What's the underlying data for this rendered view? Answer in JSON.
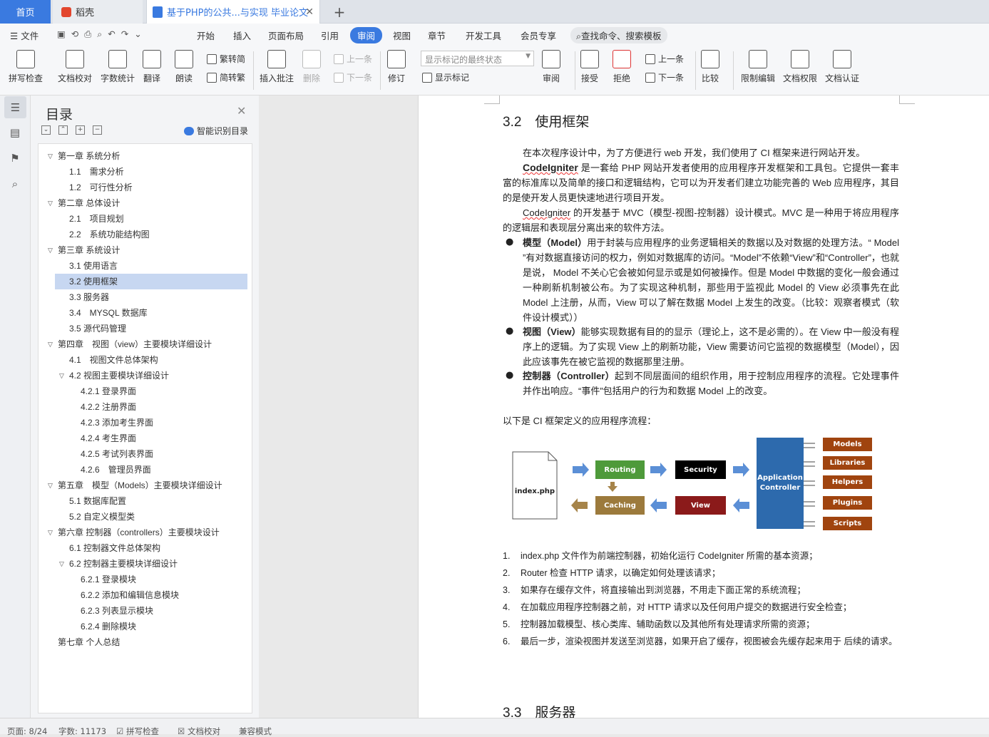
{
  "tabs": {
    "home": "首页",
    "daoke": "稻壳",
    "doc": "基于PHP的公共...与实现 毕业论文",
    "new": "+"
  },
  "menu": {
    "file": "文件",
    "items": [
      "开始",
      "插入",
      "页面布局",
      "引用",
      "审阅",
      "视图",
      "章节",
      "开发工具",
      "会员专享"
    ],
    "active": "审阅",
    "search": "查找命令、搜索模板"
  },
  "ribbon": {
    "spell": "拼写检查",
    "proof": "文档校对",
    "count": "字数统计",
    "translate": "翻译",
    "read": "朗读",
    "trad": "繁转简",
    "simp": "简转繁",
    "insert_comment": "插入批注",
    "delete": "删除",
    "prev": "上一条",
    "next": "下一条",
    "revise": "修订",
    "display_select": "显示标记的最终状态",
    "show_marks": "显示标记",
    "review": "审阅",
    "accept": "接受",
    "reject": "拒绝",
    "prev2": "上一条",
    "next2": "下一条",
    "compare": "比较",
    "restrict": "限制编辑",
    "perm": "文档权限",
    "cert": "文档认证"
  },
  "toc": {
    "title": "目录",
    "ai": "智能识别目录",
    "items": [
      {
        "text": "第一章 系统分析",
        "level": 0,
        "caret": "v"
      },
      {
        "text": "1.1　需求分析",
        "level": 1
      },
      {
        "text": "1.2　可行性分析",
        "level": 1
      },
      {
        "text": "第二章 总体设计",
        "level": 0,
        "caret": "v"
      },
      {
        "text": "2.1　项目规划",
        "level": 1
      },
      {
        "text": "2.2　系统功能结构图",
        "level": 1
      },
      {
        "text": "第三章 系统设计",
        "level": 0,
        "caret": "v"
      },
      {
        "text": "3.1 使用语言",
        "level": 1
      },
      {
        "text": "3.2 使用框架",
        "level": 1,
        "selected": true
      },
      {
        "text": "3.3 服务器",
        "level": 1
      },
      {
        "text": "3.4　MYSQL 数据库",
        "level": 1
      },
      {
        "text": "3.5 源代码管理",
        "level": 1
      },
      {
        "text": "第四章　视图（view）主要模块详细设计",
        "level": 0,
        "caret": "v"
      },
      {
        "text": "4.1　视图文件总体架构",
        "level": 1
      },
      {
        "text": "4.2 视图主要模块详细设计",
        "level": 1,
        "caret": "v"
      },
      {
        "text": "4.2.1 登录界面",
        "level": 2
      },
      {
        "text": "4.2.2 注册界面",
        "level": 2
      },
      {
        "text": "4.2.3 添加考生界面",
        "level": 2
      },
      {
        "text": "4.2.4 考生界面",
        "level": 2
      },
      {
        "text": "4.2.5 考试列表界面",
        "level": 2
      },
      {
        "text": "4.2.6　管理员界面",
        "level": 2
      },
      {
        "text": "第五章　模型（Models）主要模块详细设计",
        "level": 0,
        "caret": "v"
      },
      {
        "text": "5.1 数据库配置",
        "level": 1
      },
      {
        "text": "5.2 自定义模型类",
        "level": 1
      },
      {
        "text": "第六章 控制器（controllers）主要模块设计",
        "level": 0,
        "caret": "v"
      },
      {
        "text": "6.1 控制器文件总体架构",
        "level": 1
      },
      {
        "text": "6.2 控制器主要模块详细设计",
        "level": 1,
        "caret": "v"
      },
      {
        "text": "6.2.1 登录模块",
        "level": 2
      },
      {
        "text": "6.2.2 添加和编辑信息模块",
        "level": 2
      },
      {
        "text": "6.2.3 列表显示模块",
        "level": 2
      },
      {
        "text": "6.2.4 删除模块",
        "level": 2
      },
      {
        "text": "第七章 个人总结",
        "level": 0
      }
    ]
  },
  "doc": {
    "h_32": "3.2　使用框架",
    "p1": "在本次程序设计中，为了方便进行 web 开发，我们使用了 CI 框架来进行网站开发。",
    "p2a": "CodeIgniter",
    "p2b": " 是一套给 PHP 网站开发者使用的应用程序开发框架和工具包。它提供一套丰富的标准库以及简单的接口和逻辑结构，它可以为开发者们建立功能完善的 Web 应用程序，其目的是使开发人员更快速地进行项目开发。",
    "p3a": "CodeIgniter",
    "p3b": " 的开发基于 MVC（模型-视图-控制器）设计模式。MVC 是一种用于将应用程序的逻辑层和表现层分离出来的软件方法。",
    "b1a": "模型（Model）",
    "b1b": "用于封装与应用程序的业务逻辑相关的数据以及对数据的处理方法。“ Model ”有对数据直接访问的权力，例如对数据库的访问。“Model”不依赖“View”和“Controller”，也就是说， Model 不关心它会被如何显示或是如何被操作。但是 Model 中数据的变化一般会通过一种刷新机制被公布。为了实现这种机制，那些用于监视此 Model 的 View 必须事先在此 Model 上注册，从而，View 可以了解在数据 Model 上发生的改变。（比较：观察者模式（软件设计模式））",
    "b2a": "视图（View）",
    "b2b": "能够实现数据有目的的显示（理论上，这不是必需的）。在 View 中一般没有程序上的逻辑。为了实现 View 上的刷新功能，View 需要访问它监视的数据模型（Model），因此应该事先在被它监视的数据那里注册。",
    "b3a": "控制器（Controller）",
    "b3b": "起到不同层面间的组织作用，用于控制应用程序的流程。它处理事件并作出响应。“事件”包括用户的行为和数据 Model 上的改变。",
    "p4": "以下是 CI 框架定义的应用程序流程：",
    "flow": {
      "index": "index.php",
      "routing": "Routing",
      "security": "Security",
      "caching": "Caching",
      "view": "View",
      "app": "Application Controller",
      "models": "Models",
      "libraries": "Libraries",
      "helpers": "Helpers",
      "plugins": "Plugins",
      "scripts": "Scripts"
    },
    "list": [
      {
        "n": "1.",
        "t": "index.php 文件作为前端控制器，初始化运行 CodeIgniter 所需的基本资源；"
      },
      {
        "n": "2.",
        "t": "Router 检查 HTTP 请求，以确定如何处理该请求；"
      },
      {
        "n": "3.",
        "t": "如果存在缓存文件，将直接输出到浏览器，不用走下面正常的系统流程；"
      },
      {
        "n": "4.",
        "t": "在加载应用程序控制器之前，对 HTTP 请求以及任何用户提交的数据进行安全检查；"
      },
      {
        "n": "5.",
        "t": "控制器加载模型、核心类库、辅助函数以及其他所有处理请求所需的资源；"
      },
      {
        "n": "6.",
        "t": "最后一步，渲染视图并发送至浏览器，如果开启了缓存，视图被会先缓存起来用于 后续的请求。"
      }
    ],
    "h_33": "3.3　服务器"
  },
  "status": {
    "page": "页面: 8/24",
    "words": "字数: 11173",
    "spell": "拼写检查",
    "proof": "文档校对",
    "compat": "兼容模式"
  },
  "colors": {
    "accent": "#3a7ae0",
    "routing": "#4e9a3a",
    "security": "#000000",
    "caching": "#9c7a3c",
    "view": "#8b1a1a",
    "app": "#2d6aad",
    "lib": "#a0440f"
  }
}
